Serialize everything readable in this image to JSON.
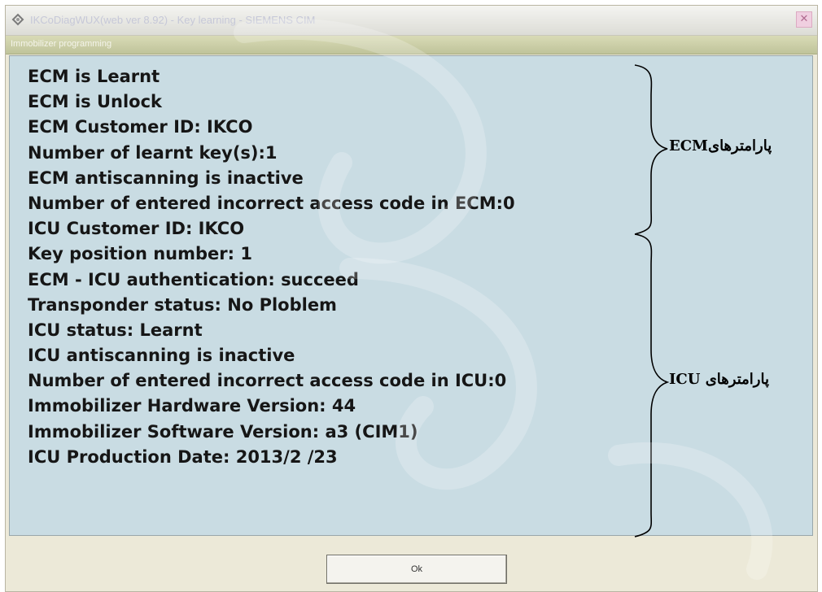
{
  "window": {
    "title": "IKCoDiagWUX(web ver 8.92) - Key learning - SIEMENS CIM",
    "close_glyph": "✕",
    "icon": "app-logo-icon"
  },
  "group": {
    "label": "Immobilizer programming"
  },
  "info_lines": [
    "ECM is Learnt",
    "ECM is Unlock",
    "ECM Customer ID: IKCO",
    "Number of learnt key(s):1",
    "ECM antiscanning is inactive",
    "Number of entered incorrect access code in ECM:0",
    "ICU Customer ID: IKCO",
    "Key position number: 1",
    "ECM - ICU authentication: succeed",
    "Transponder status: No Ploblem",
    "ICU status: Learnt",
    "ICU antiscanning is inactive",
    "Number of entered incorrect access code in ICU:0",
    "Immobilizer Hardware Version: 44",
    "Immobilizer Software Version: a3 (CIM1)",
    "ICU Production Date: 2013/2 /23"
  ],
  "annotations": {
    "ecm": "پارامترهایECM",
    "icu": "پارامترهای ICU"
  },
  "buttons": {
    "ok_label": "Ok"
  },
  "colors": {
    "panel_bg": "#c9dce3",
    "group_bar": "#c4c8a0",
    "window_bg": "#ece9d8"
  }
}
